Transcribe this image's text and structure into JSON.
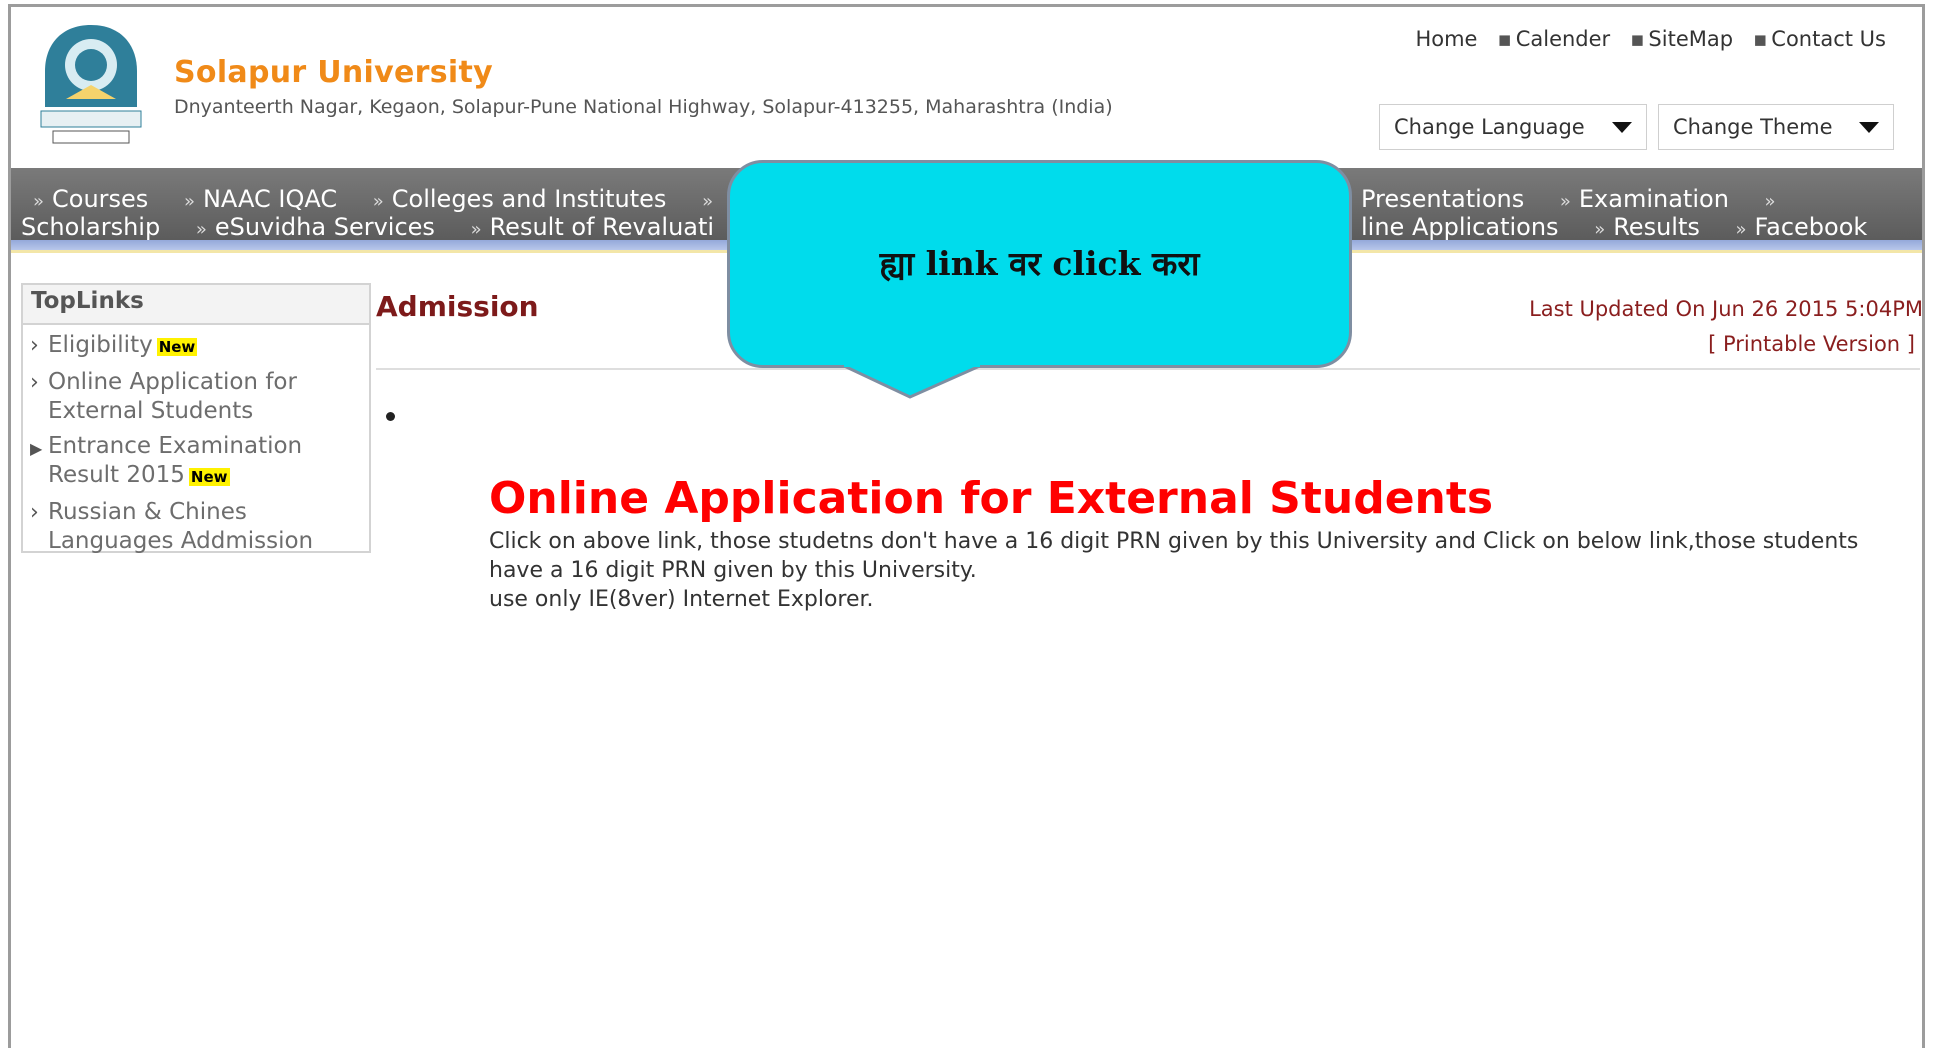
{
  "header": {
    "university_name": "Solapur University",
    "address": "Dnyanteerth Nagar, Kegaon, Solapur-Pune National Highway, Solapur-413255, Maharashtra (India)",
    "top_links": [
      "Home",
      "Calender",
      "SiteMap",
      "Contact Us"
    ],
    "language_select": "Change Language",
    "theme_select": "Change Theme"
  },
  "nav": {
    "line1_left": [
      "Courses",
      "NAAC IQAC",
      "Colleges and Institutes"
    ],
    "line1_right": [
      "Presentations",
      "Examination"
    ],
    "line2_left_first": "Scholarship",
    "line2_left": [
      "eSuvidha Services",
      "Result of Revaluati"
    ],
    "line2_right_partial": "line Applications",
    "line2_right": [
      "Results",
      "Facebook"
    ]
  },
  "sidebar": {
    "title": "TopLinks",
    "items": [
      {
        "label": "Eligibility",
        "badge": "New"
      },
      {
        "label": "Online Application for External Students",
        "badge": ""
      },
      {
        "label": "Entrance Examination Result 2015",
        "badge": "New"
      },
      {
        "label": "Russian & Chines Languages Addmission",
        "badge": ""
      }
    ]
  },
  "content": {
    "page_title": "Admission",
    "last_updated": "Last Updated On Jun 26 2015 5:04PM",
    "printable": "[ Printable Version ]",
    "heading": "Online Application for External Students",
    "text_line1": "Click on above link, those studetns don't have a 16 digit PRN given by this University and Click on below link,those students have a 16 digit PRN given by this University.",
    "text_line2": "use only IE(8ver) Internet Explorer."
  },
  "callout": {
    "text": "ह्या link वर click करा"
  },
  "colors": {
    "uni_orange": "#f08a18",
    "nav_gray": "#666666",
    "heading_red": "#ff0000",
    "title_maroon": "#7d1a1a",
    "callout_cyan": "#00dcec"
  }
}
